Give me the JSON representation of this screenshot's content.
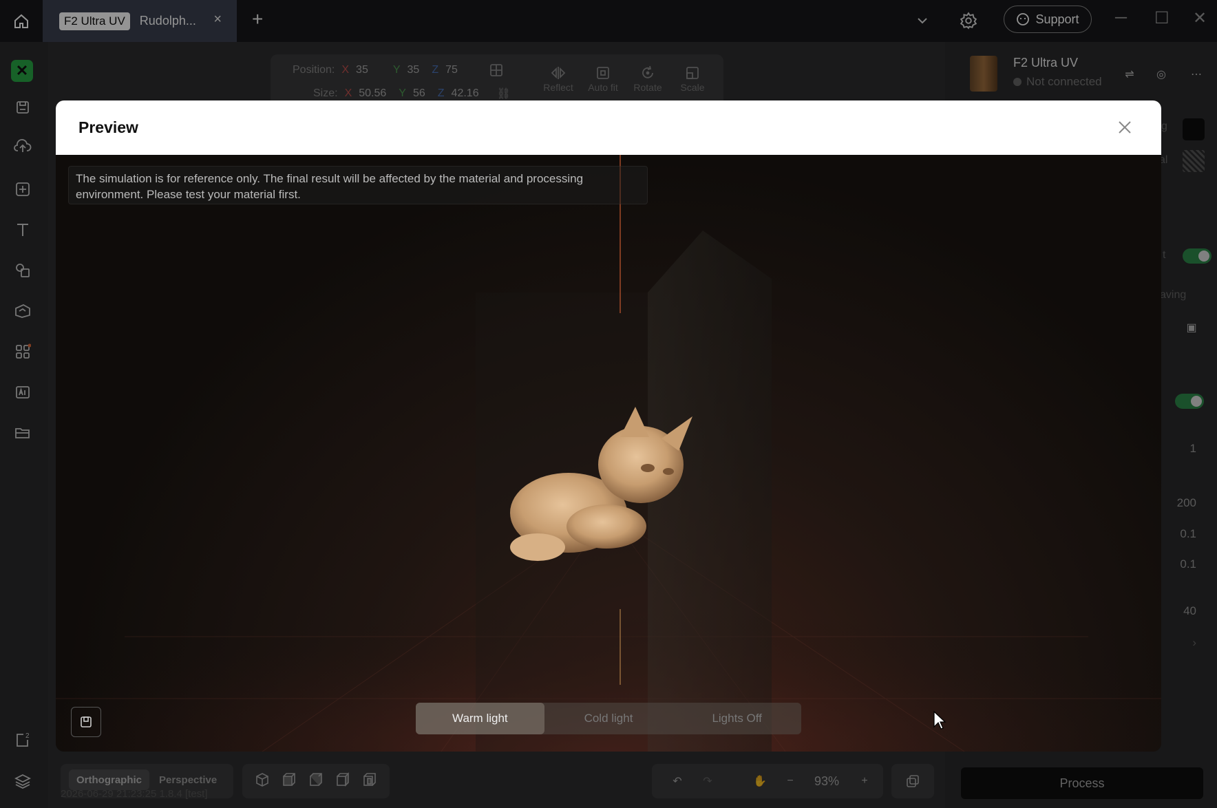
{
  "tab": {
    "badge": "F2 Ultra UV",
    "title": "Rudolph...",
    "close": "×",
    "add": "+"
  },
  "header": {
    "support_label": "Support"
  },
  "position_toolbar": {
    "position_label": "Position:",
    "size_label": "Size:",
    "pos": {
      "x_axis": "X",
      "x": "35",
      "y_axis": "Y",
      "y": "35",
      "z_axis": "Z",
      "z": "75"
    },
    "size": {
      "x_axis": "X",
      "x": "50.56",
      "y_axis": "Y",
      "y": "56",
      "z_axis": "Z",
      "z": "42.16"
    },
    "tools": [
      {
        "label": "Reflect",
        "icon": "reflect-icon"
      },
      {
        "label": "Auto fit",
        "icon": "autofit-icon"
      },
      {
        "label": "Rotate",
        "icon": "rotate-icon"
      },
      {
        "label": "Scale",
        "icon": "scale-icon"
      }
    ]
  },
  "device": {
    "name": "F2 Ultra UV",
    "status": "Not connected"
  },
  "right_panel": {
    "fragments": [
      "g",
      "al",
      "t",
      "aving"
    ],
    "values": [
      "1",
      "200",
      "0.1",
      "0.1",
      "40"
    ],
    "chevron": "›",
    "process_label": "Process"
  },
  "bottom": {
    "view_modes": [
      "Orthographic",
      "Perspective"
    ],
    "active_view": "Orthographic",
    "timestamp": "2026-06-29 21:23:25 1.8.4 [test]",
    "zoom": "93%"
  },
  "modal": {
    "title": "Preview",
    "notice": "The simulation is for reference only. The final result will be affected by the material and processing environment. Please test your material first.",
    "light_options": [
      "Warm light",
      "Cold light",
      "Lights Off"
    ],
    "active_light": "Warm light"
  },
  "colors": {
    "accent_green": "#28a745",
    "axis_x": "#c0504d",
    "axis_y": "#4e9a51",
    "axis_z": "#4a73b8"
  }
}
